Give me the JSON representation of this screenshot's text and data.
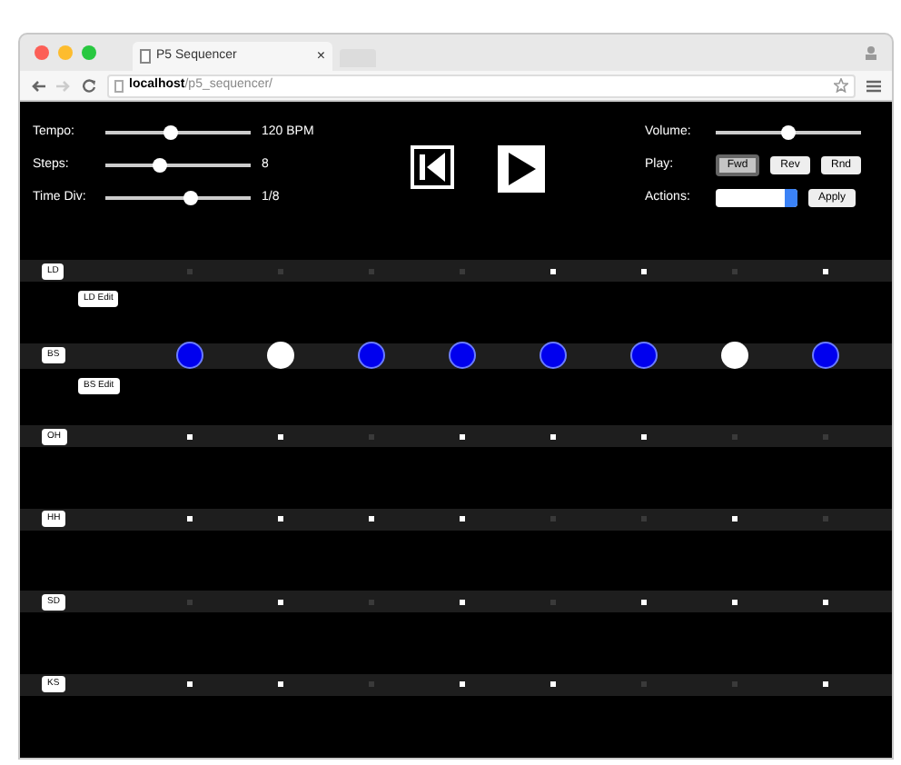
{
  "browser": {
    "tab_title": "P5 Sequencer",
    "tab_close": "×",
    "url_host": "localhost",
    "url_path": "/p5_sequencer/"
  },
  "sliders": [
    {
      "label": "Tempo:",
      "level": 0.45,
      "reading": "120 BPM"
    },
    {
      "label": "Steps:",
      "level": 0.36,
      "reading": "8"
    },
    {
      "label": "Time Div:",
      "level": 0.6,
      "reading": "1/8"
    }
  ],
  "volume": {
    "label": "Volume:",
    "level": 0.5
  },
  "play": {
    "label": "Play:",
    "modes": [
      {
        "label": "Fwd",
        "selected": true
      },
      {
        "label": "Rev",
        "selected": false
      },
      {
        "label": "Rnd",
        "selected": false
      }
    ]
  },
  "actions": {
    "label": "Actions:",
    "button": "Apply"
  },
  "tracks": [
    {
      "label": "LD",
      "kind": "small",
      "edit": "LD Edit",
      "steps": [
        false,
        false,
        false,
        false,
        true,
        true,
        false,
        true
      ]
    },
    {
      "label": "BS",
      "kind": "large",
      "edit": "BS Edit",
      "steps": [
        true,
        false,
        true,
        true,
        true,
        true,
        false,
        true
      ]
    },
    {
      "label": "OH",
      "kind": "small",
      "steps": [
        true,
        true,
        false,
        true,
        true,
        true,
        false,
        false
      ]
    },
    {
      "label": "HH",
      "kind": "small",
      "steps": [
        true,
        true,
        true,
        true,
        false,
        false,
        true,
        false
      ]
    },
    {
      "label": "SD",
      "kind": "small",
      "steps": [
        false,
        true,
        false,
        true,
        false,
        true,
        true,
        true
      ]
    },
    {
      "label": "KS",
      "kind": "small",
      "steps": [
        true,
        true,
        false,
        true,
        true,
        false,
        false,
        true
      ]
    }
  ]
}
